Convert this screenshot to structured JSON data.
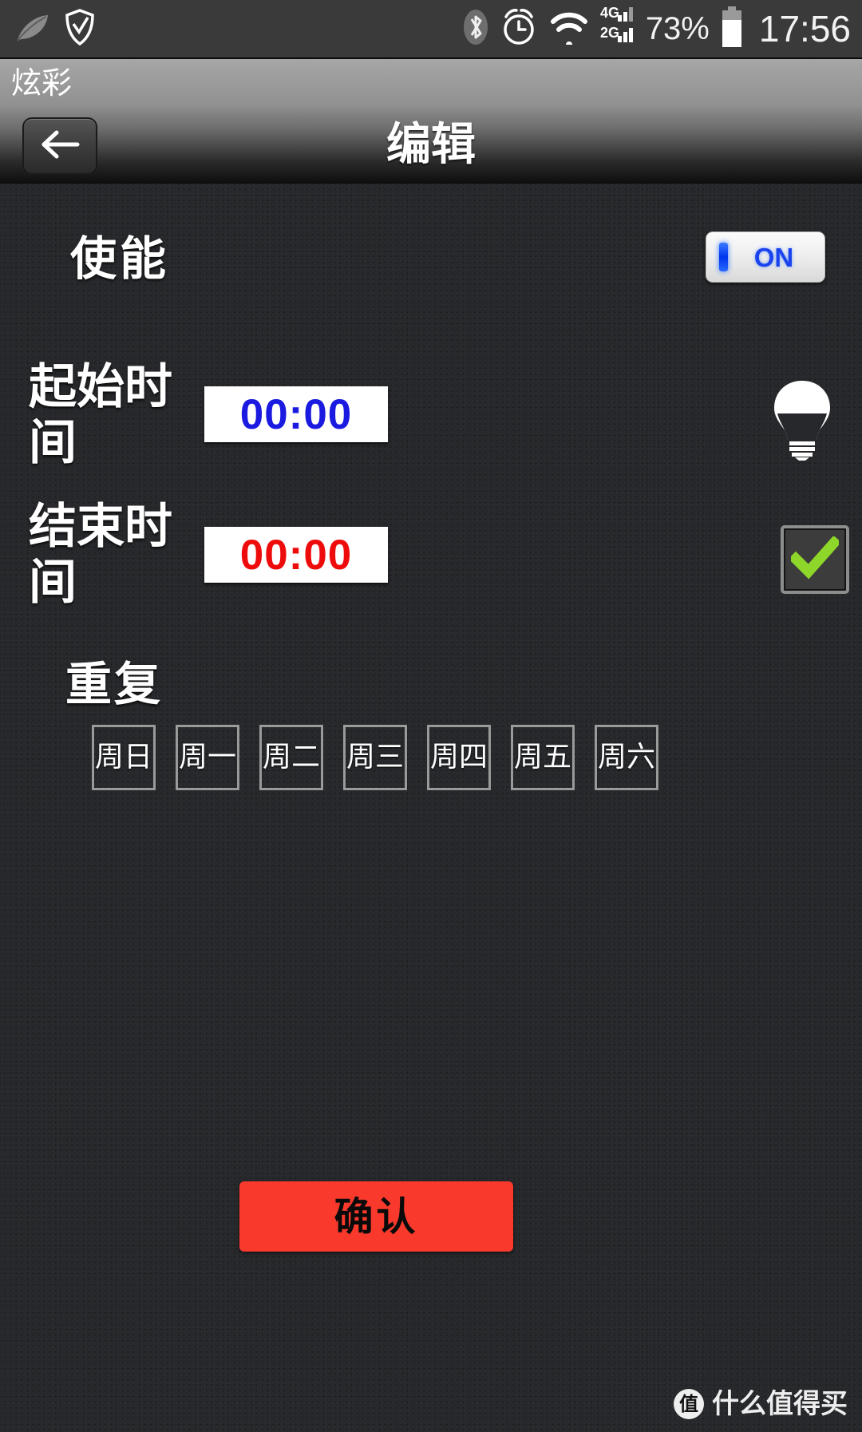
{
  "status_bar": {
    "icons": [
      "leaf-icon",
      "shield-check-icon",
      "bluetooth-icon",
      "alarm-clock-icon",
      "wifi-icon",
      "signal-4g-icon",
      "signal-2g-icon"
    ],
    "network_4g_label": "4G",
    "network_2g_label": "2G",
    "battery_percent": "73%",
    "clock": "17:56"
  },
  "app_bar": {
    "title": "炫彩"
  },
  "nav_bar": {
    "back_icon": "arrow-left-icon",
    "title": "编辑"
  },
  "form": {
    "enable": {
      "label": "使能",
      "toggle_state": "ON"
    },
    "start_time": {
      "label": "起始时间",
      "value": "00:00",
      "color": "#1a1ae0",
      "indicator_icon": "light-bulb-icon"
    },
    "end_time": {
      "label": "结束时间",
      "value": "00:00",
      "color": "#ee0b0b",
      "indicator_icon": "check-mark-icon"
    },
    "repeat": {
      "label": "重复",
      "days": [
        {
          "label": "周日",
          "selected": false
        },
        {
          "label": "周一",
          "selected": false
        },
        {
          "label": "周二",
          "selected": false
        },
        {
          "label": "周三",
          "selected": false
        },
        {
          "label": "周四",
          "selected": false
        },
        {
          "label": "周五",
          "selected": false
        },
        {
          "label": "周六",
          "selected": false
        }
      ]
    }
  },
  "confirm": {
    "label": "确认",
    "color": "#f9392c"
  },
  "watermark": {
    "badge": "值",
    "text": "什么值得买"
  }
}
